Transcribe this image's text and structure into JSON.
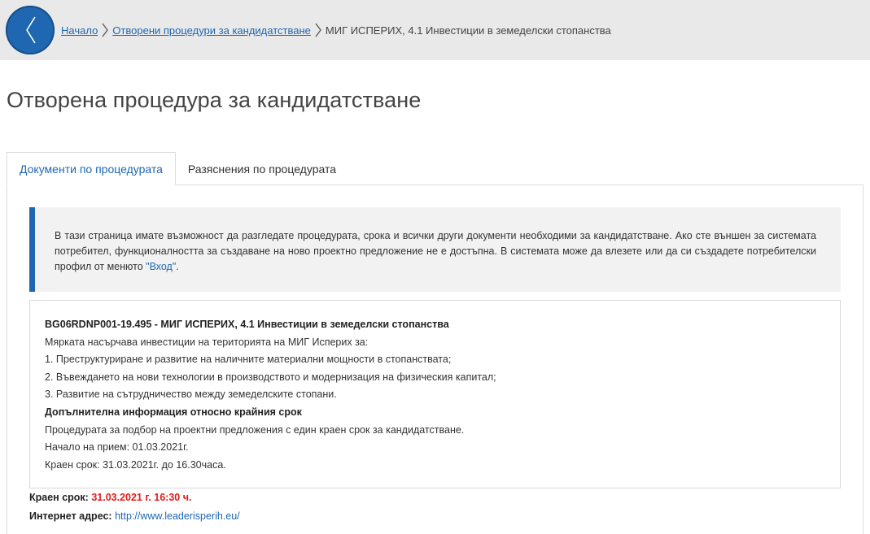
{
  "breadcrumb": {
    "items": [
      {
        "label": "Начало"
      },
      {
        "label": "Отворени процедури за кандидатстване"
      }
    ],
    "current": "МИГ ИСПЕРИХ, 4.1 Инвестиции в земеделски стопанства"
  },
  "page": {
    "title": "Отворена процедура за кандидатстване"
  },
  "tabs": [
    {
      "label": "Документи по процедурата",
      "active": true
    },
    {
      "label": "Разяснения по процедурата",
      "active": false
    }
  ],
  "notice": {
    "text_before": "В тази страница имате възможност да разгледате процедурата, срока и всички други документи необходими за кандидатстване. Ако сте външен за системата потребител, функционалността за създаване на ново проектно предложение не е достъпна. В системата може да влезете или да си създадете потребителски профил от менюто ",
    "link_text": "\"Вход\"",
    "text_after": "."
  },
  "procedure": {
    "heading": "BG06RDNP001-19.495 - МИГ ИСПЕРИХ, 4.1 Инвестиции в земеделски стопанства",
    "intro": "Мярката насърчава инвестиции на територията на МИГ Исперих за:",
    "points": [
      "1. Преструктуриране и развитие на наличните материални мощности в стопанствата;",
      "2. Въвеждането на нови технологии в производството и модернизация на физическия капитал;",
      "3. Развитие на сътрудничество между земеделските стопани."
    ],
    "extra_heading": "Допълнителна информация относно крайния срок",
    "extra_lines": [
      "Процедурата за подбор на проектни предложения с един краен срок за кандидатстване.",
      "Начало на прием: 01.03.2021г.",
      "Краен срок: 31.03.2021г. до 16.30часа."
    ]
  },
  "deadline": {
    "label": "Краен срок:",
    "value": "31.03.2021 г. 16:30 ч."
  },
  "website": {
    "label": "Интернет адрес:",
    "value": "http://www.leaderisperih.eu/"
  },
  "colors": {
    "accent": "#1f67b1",
    "deadline": "#e31b1b",
    "topbar": "#e9e9e9",
    "notice_bg": "#f2f2f2"
  },
  "icons": {
    "back": "chevron-left-icon",
    "separator": "chevron-right-icon"
  }
}
